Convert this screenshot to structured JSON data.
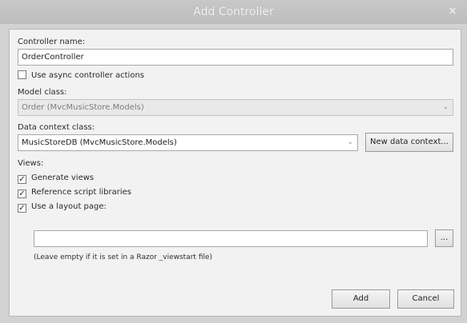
{
  "dialog": {
    "title": "Add Controller",
    "close_glyph": "✕"
  },
  "controller_name": {
    "label": "Controller name:",
    "value": "OrderController"
  },
  "async_actions": {
    "label": "Use async controller actions",
    "checked": false
  },
  "model_class": {
    "label": "Model class:",
    "value": "Order (MvcMusicStore.Models)"
  },
  "data_context": {
    "label": "Data context class:",
    "value": "MusicStoreDB (MvcMusicStore.Models)",
    "new_button": "New data context..."
  },
  "views": {
    "label": "Views:",
    "generate_views": {
      "label": "Generate views",
      "checked": true
    },
    "reference_scripts": {
      "label": "Reference script libraries",
      "checked": true
    },
    "use_layout": {
      "label": "Use a layout page:",
      "checked": true
    },
    "layout_path": {
      "value": ""
    },
    "browse_button": "...",
    "hint": "(Leave empty if it is set in a Razor _viewstart file)"
  },
  "footer": {
    "add_button": "Add",
    "cancel_button": "Cancel"
  },
  "icons": {
    "check": "✓",
    "dropdown": "⌄"
  }
}
